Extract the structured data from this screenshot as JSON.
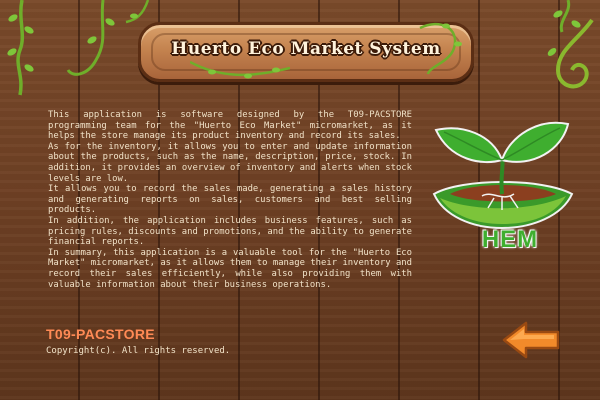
{
  "window": {
    "title": "Huerto Eco Market System"
  },
  "about": {
    "paragraphs": [
      "This application is software designed by the T09-PACSTORE programming team for the \"Huerto Eco Market\" micromarket, as it helps the store manage its product inventory and record its sales.",
      "As for the inventory, it allows you to enter and update information about the products, such as the name, description, price, stock. In addition, it provides an overview of inventory and alerts when stock levels are low.",
      "It allows you to record the sales made, generating a sales history and generating reports on sales, customers and best selling products.",
      "In addition, the application includes business features, such as pricing rules, discounts and promotions, and the ability to generate financial reports.",
      "In summary, this application is a valuable tool for the \"Huerto Eco Market\" micromarket, as it allows them to manage their inventory and record their sales efficiently, while also providing them with valuable information about their business operations."
    ],
    "team": "T09-PACSTORE",
    "copyright": "Copyright(c). All rights reserved."
  },
  "logo": {
    "text": "HEM",
    "icon": "sprout-icon"
  },
  "nav": {
    "back_icon": "back-arrow-icon"
  },
  "colors": {
    "wood": "#6e4024",
    "board": "#c4834f",
    "accent": "#ff8a55",
    "leaf": "#3fae2f",
    "text": "#f1e2c8"
  }
}
